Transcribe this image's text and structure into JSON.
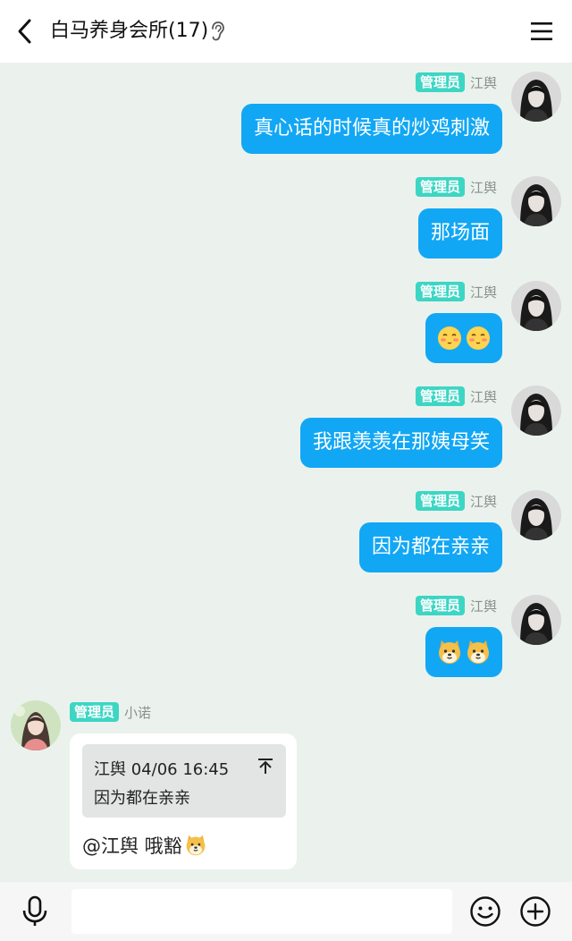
{
  "header": {
    "title": "白马养身会所(17)"
  },
  "badge_label": "管理员",
  "sender_right": "江舆",
  "messages": [
    {
      "text": "真心话的时候真的炒鸡刺激"
    },
    {
      "text": "那场面"
    },
    {
      "emoji": "blush-emoji"
    },
    {
      "text": "我跟羡羡在那姨母笑"
    },
    {
      "text": "因为都在亲亲"
    },
    {
      "emoji": "doge-emoji"
    }
  ],
  "reply": {
    "badge": "管理员",
    "sender": "小诺",
    "quote_header": "江舆 04/06 16:45",
    "quote_text": "因为都在亲亲",
    "text": "@江舆 哦豁"
  },
  "input": {
    "placeholder": ""
  },
  "colors": {
    "bubble_self": "#12a7f4",
    "badge": "#3dd6c4",
    "background": "#ebf2ed"
  }
}
